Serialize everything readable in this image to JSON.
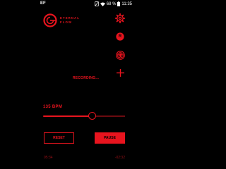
{
  "status_bar": {
    "carrier": "EF",
    "battery": "68 %",
    "time": "11:35",
    "icons": [
      "no-sim-icon",
      "wifi-icon",
      "battery-icon"
    ]
  },
  "logo": {
    "line1": "ETERNAL",
    "line2": "FLOW",
    "icon": "eternal-flow-logo-icon"
  },
  "actions": {
    "settings_icon": "gear-icon",
    "record_label": "R",
    "metronome_icon": "flower-icon",
    "add_icon": "plus-icon"
  },
  "recording_status": "RECORDING...",
  "tempo": {
    "label": "135 BPM",
    "value": 135,
    "slider_fraction": 0.6
  },
  "buttons": {
    "reset_label": "RESET",
    "pause_label": "PAUSE"
  },
  "timeline": {
    "elapsed": "05:34",
    "remaining": "-02:32"
  },
  "colors": {
    "background": "#000000",
    "accent": "#e8141e",
    "dim_accent": "#9a1016"
  }
}
